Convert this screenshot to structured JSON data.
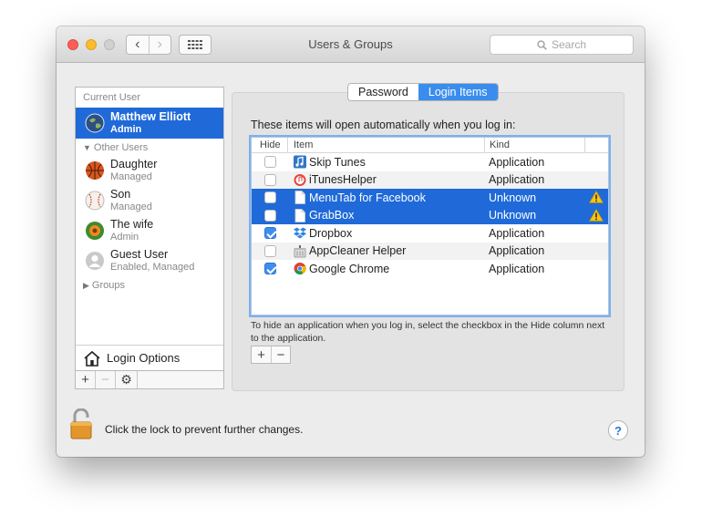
{
  "window": {
    "title": "Users & Groups"
  },
  "search": {
    "placeholder": "Search"
  },
  "sidebar": {
    "current_user_header": "Current User",
    "current_user": {
      "name": "Matthew Elliott",
      "role": "Admin"
    },
    "other_users_header": "Other Users",
    "other_users": [
      {
        "name": "Daughter",
        "role": "Managed"
      },
      {
        "name": "Son",
        "role": "Managed"
      },
      {
        "name": "The wife",
        "role": "Admin"
      },
      {
        "name": "Guest User",
        "role": "Enabled, Managed"
      }
    ],
    "groups_header": "Groups",
    "login_options": "Login Options"
  },
  "tabs": [
    {
      "label": "Password",
      "active": false
    },
    {
      "label": "Login Items",
      "active": true
    }
  ],
  "login_items": {
    "intro": "These items will open automatically when you log in:",
    "columns": {
      "hide": "Hide",
      "item": "Item",
      "kind": "Kind"
    },
    "rows": [
      {
        "name": "Skip Tunes",
        "kind": "Application",
        "hide": false,
        "icon": "skip-tunes-icon"
      },
      {
        "name": "iTunesHelper",
        "kind": "Application",
        "hide": false,
        "icon": "itunes-helper-icon"
      },
      {
        "name": "MenuTab for Facebook",
        "kind": "Unknown",
        "hide": false,
        "icon": "document-icon"
      },
      {
        "name": "GrabBox",
        "kind": "Unknown",
        "hide": false,
        "icon": "document-icon"
      },
      {
        "name": "Dropbox",
        "kind": "Application",
        "hide": true,
        "icon": "dropbox-icon"
      },
      {
        "name": "AppCleaner Helper",
        "kind": "Application",
        "hide": false,
        "icon": "appcleaner-icon"
      },
      {
        "name": "Google Chrome",
        "kind": "Application",
        "hide": true,
        "icon": "chrome-icon"
      }
    ],
    "hint": "To hide an application when you log in, select the checkbox in the Hide column next to the application."
  },
  "footer": {
    "lock_text": "Click the lock to prevent further changes.",
    "help_label": "?"
  },
  "colors": {
    "selection": "#1f6ad8",
    "tab_active": "#3a8dee",
    "warning": "#f5c518"
  }
}
